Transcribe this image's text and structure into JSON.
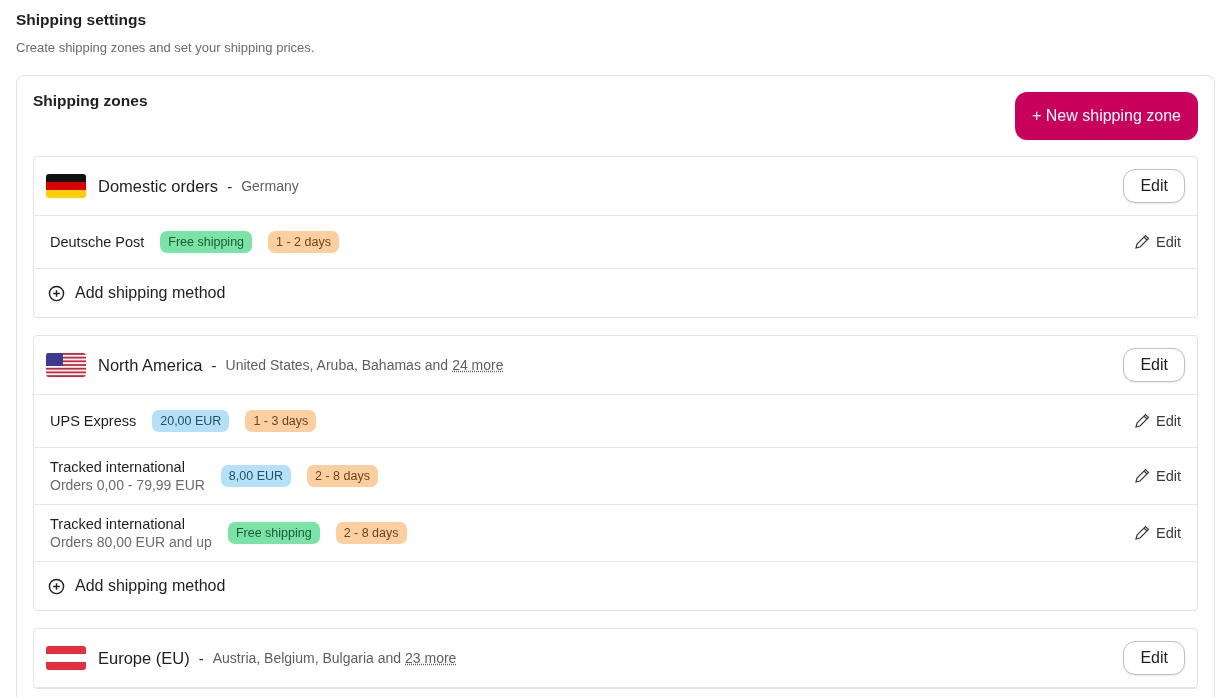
{
  "page": {
    "title": "Shipping settings",
    "subtitle": "Create shipping zones and set your shipping prices."
  },
  "panel": {
    "title": "Shipping zones",
    "new_button": "+ New shipping zone"
  },
  "zones": [
    {
      "kind": "de",
      "name": "Domestic orders",
      "separator": "-",
      "countries": "Germany",
      "edit_button": "Edit",
      "methods": [
        {
          "name": "Deutsche Post",
          "badges": [
            {
              "kind": "free",
              "text": "Free shipping"
            },
            {
              "kind": "time",
              "text": "1 - 2 days"
            }
          ],
          "edit": "Edit"
        }
      ],
      "add_method": "Add shipping method"
    },
    {
      "kind": "us",
      "name": "North America",
      "separator": "-",
      "countries": "United States, Aruba, Bahamas and",
      "more_link": "24 more",
      "edit_button": "Edit",
      "methods": [
        {
          "name": "UPS Express",
          "badges": [
            {
              "kind": "price",
              "text": "20,00 EUR"
            },
            {
              "kind": "time",
              "text": "1 - 3 days"
            }
          ],
          "edit": "Edit"
        },
        {
          "name": "Tracked international",
          "note": "Orders 0,00 - 79,99 EUR",
          "badges": [
            {
              "kind": "price",
              "text": "8,00 EUR"
            },
            {
              "kind": "time",
              "text": "2 - 8 days"
            }
          ],
          "edit": "Edit"
        },
        {
          "name": "Tracked international",
          "note": "Orders 80,00 EUR and up",
          "badges": [
            {
              "kind": "free",
              "text": "Free shipping"
            },
            {
              "kind": "time",
              "text": "2 - 8 days"
            }
          ],
          "edit": "Edit"
        }
      ],
      "add_method": "Add shipping method"
    },
    {
      "kind": "at",
      "name": "Europe (EU)",
      "separator": "-",
      "countries": "Austria, Belgium, Bulgaria and",
      "more_link": "23 more",
      "edit_button": "Edit"
    }
  ]
}
